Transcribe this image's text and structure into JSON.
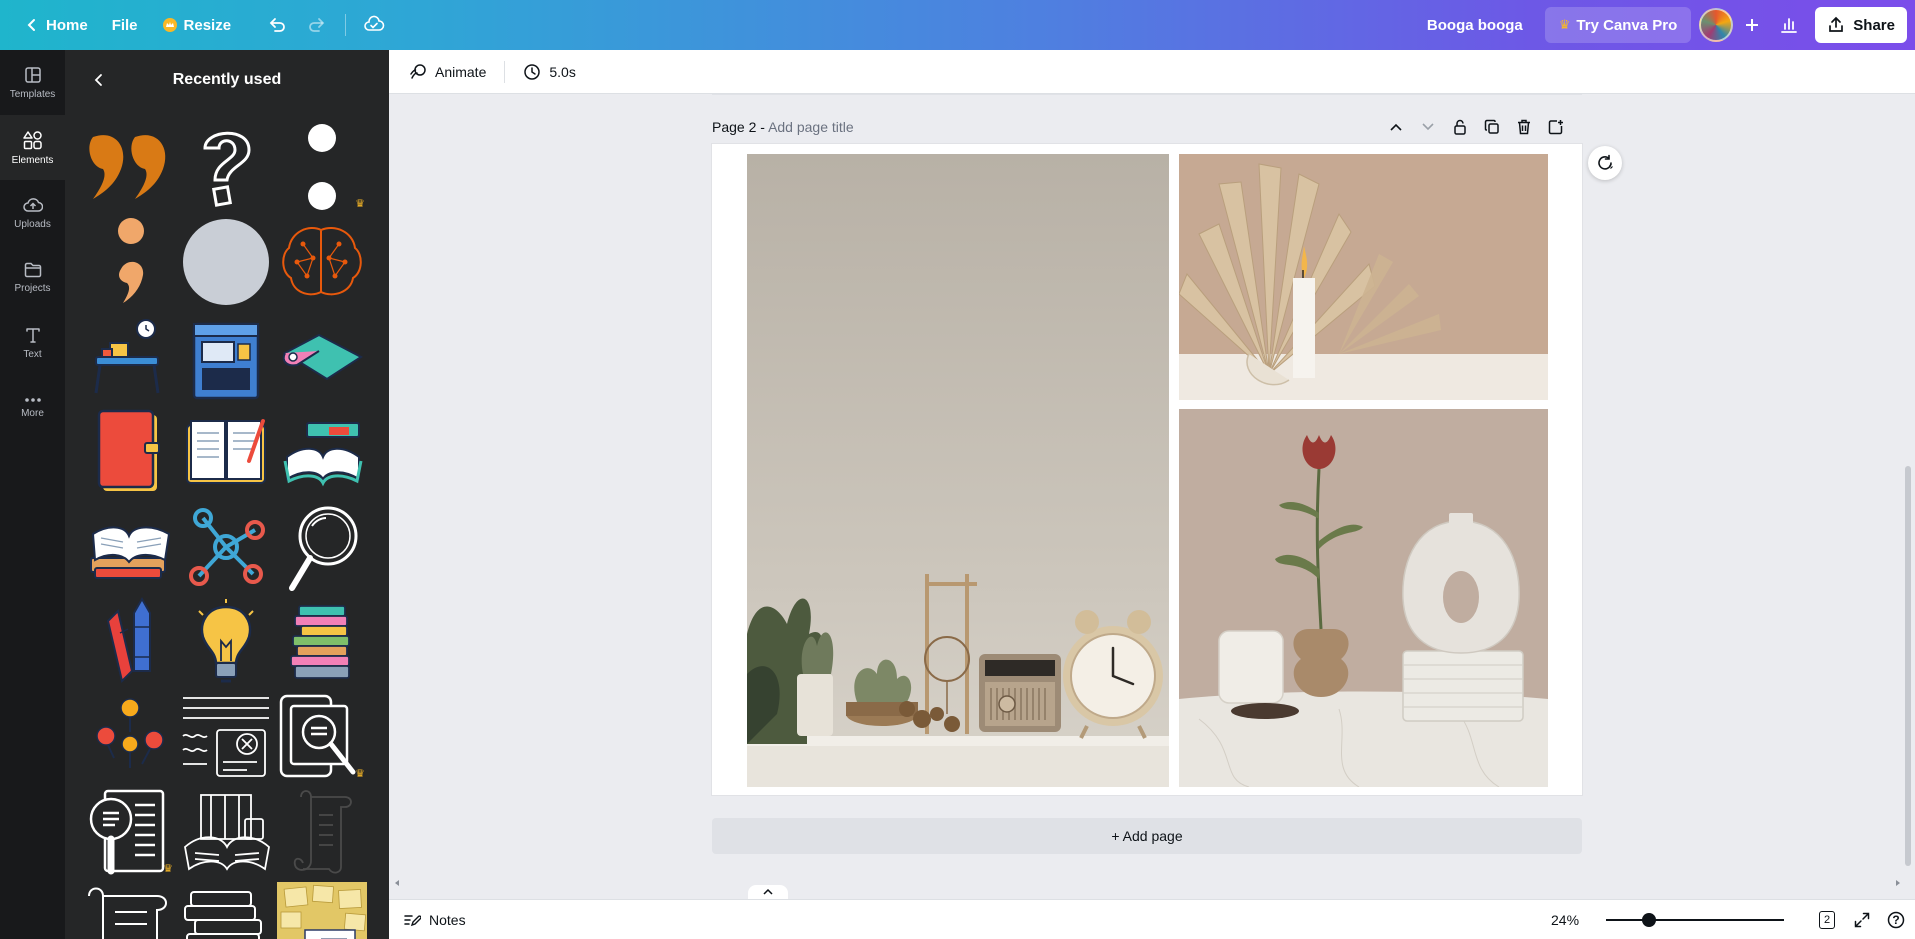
{
  "header": {
    "home_label": "Home",
    "file_label": "File",
    "resize_label": "Resize",
    "doc_name": "Booga booga",
    "try_pro_label": "Try Canva Pro",
    "share_label": "Share"
  },
  "rail": {
    "items": [
      {
        "label": "Templates",
        "icon": "templates-icon"
      },
      {
        "label": "Elements",
        "icon": "elements-icon"
      },
      {
        "label": "Uploads",
        "icon": "uploads-icon"
      },
      {
        "label": "Projects",
        "icon": "projects-icon"
      },
      {
        "label": "Text",
        "icon": "text-icon"
      },
      {
        "label": "More",
        "icon": "more-icon"
      }
    ],
    "active": "Elements"
  },
  "panel": {
    "title": "Recently used"
  },
  "toolbar": {
    "animate_label": "Animate",
    "duration_label": "5.0s"
  },
  "canvas": {
    "page_label": "Page 2 -",
    "page_title_placeholder": "Add page title",
    "add_page_label": "+ Add page"
  },
  "bottom": {
    "notes_label": "Notes",
    "zoom_label": "24%",
    "zoom_value": 24,
    "page_count": "2",
    "help_label": "?"
  },
  "colors": {
    "header_gradient_start": "#1fb5cc",
    "header_gradient_end": "#7b4dea",
    "panel_bg": "#252627",
    "rail_bg": "#18191b",
    "canvas_bg": "#ebecf0",
    "crown": "#f8b827"
  }
}
